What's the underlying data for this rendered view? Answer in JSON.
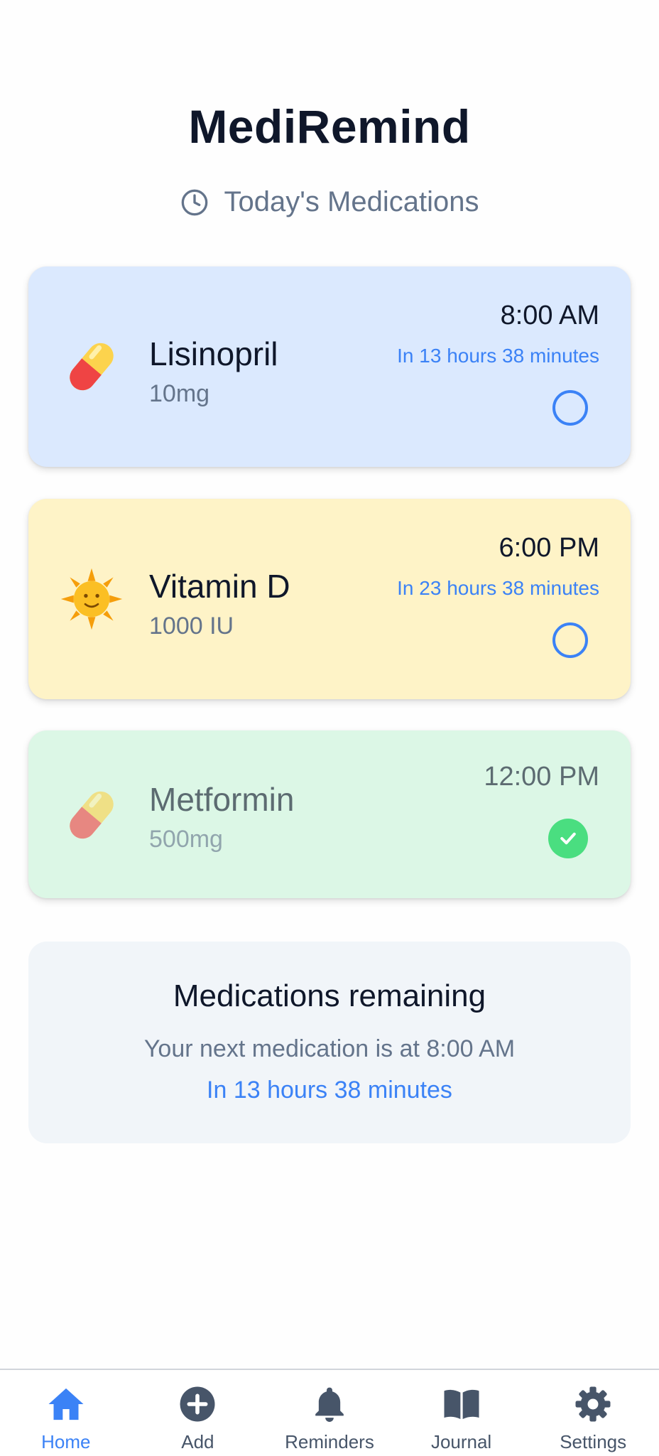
{
  "app": {
    "title": "MediRemind",
    "subtitle": "Today's Medications"
  },
  "medications": [
    {
      "name": "Lisinopril",
      "dose": "10mg",
      "time": "8:00 AM",
      "countdown": "In 13 hours 38 minutes",
      "icon": "pill-icon",
      "status": "pending"
    },
    {
      "name": "Vitamin D",
      "dose": "1000 IU",
      "time": "6:00 PM",
      "countdown": "In 23 hours 38 minutes",
      "icon": "sun-icon",
      "status": "pending"
    },
    {
      "name": "Metformin",
      "dose": "500mg",
      "time": "12:00 PM",
      "countdown": "",
      "icon": "pill-icon",
      "status": "taken"
    }
  ],
  "summary": {
    "title": "Medications remaining",
    "text": "Your next medication is at 8:00 AM",
    "countdown": "In 13 hours 38 minutes"
  },
  "nav": {
    "items": [
      {
        "label": "Home",
        "icon": "home-icon",
        "active": true
      },
      {
        "label": "Add",
        "icon": "plus-circle-icon",
        "active": false
      },
      {
        "label": "Reminders",
        "icon": "bell-icon",
        "active": false
      },
      {
        "label": "Journal",
        "icon": "book-icon",
        "active": false
      },
      {
        "label": "Settings",
        "icon": "gear-icon",
        "active": false
      }
    ]
  },
  "colors": {
    "accent": "#3b82f6",
    "card_blue": "#dbe9fe",
    "card_yellow": "#fef3c7",
    "card_green": "#dcf7e6",
    "check_green": "#4ade80"
  }
}
